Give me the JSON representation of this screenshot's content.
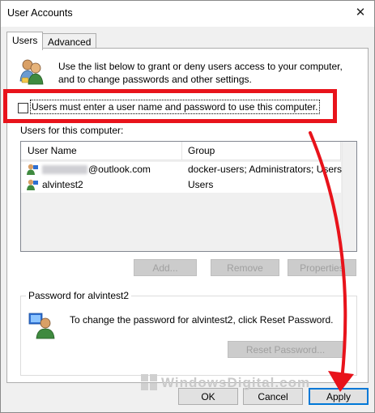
{
  "window": {
    "title": "User Accounts",
    "close_glyph": "✕"
  },
  "tabs": [
    {
      "label": "Users",
      "active": true
    },
    {
      "label": "Advanced",
      "active": false
    }
  ],
  "intro_text": "Use the list below to grant or deny users access to your computer, and to change passwords and other settings.",
  "checkbox": {
    "label": "Users must enter a user name and password to use this computer.",
    "checked": false
  },
  "users_section": {
    "label": "Users for this computer:",
    "columns": [
      "User Name",
      "Group"
    ],
    "rows": [
      {
        "user": "@outlook.com",
        "group": "docker-users; Administrators; Users",
        "icon": "user-account-icon"
      },
      {
        "user": "alvintest2",
        "group": "Users",
        "icon": "user-account-icon"
      }
    ]
  },
  "list_buttons": {
    "add": "Add...",
    "remove": "Remove",
    "properties": "Properties"
  },
  "password_group": {
    "title": "Password for alvintest2",
    "text": "To change the password for alvintest2, click Reset Password.",
    "reset_button": "Reset Password..."
  },
  "footer": {
    "ok": "OK",
    "cancel": "Cancel",
    "apply": "Apply"
  },
  "watermark": "WindowsDigital.com",
  "annotation_color": "#e8131b"
}
